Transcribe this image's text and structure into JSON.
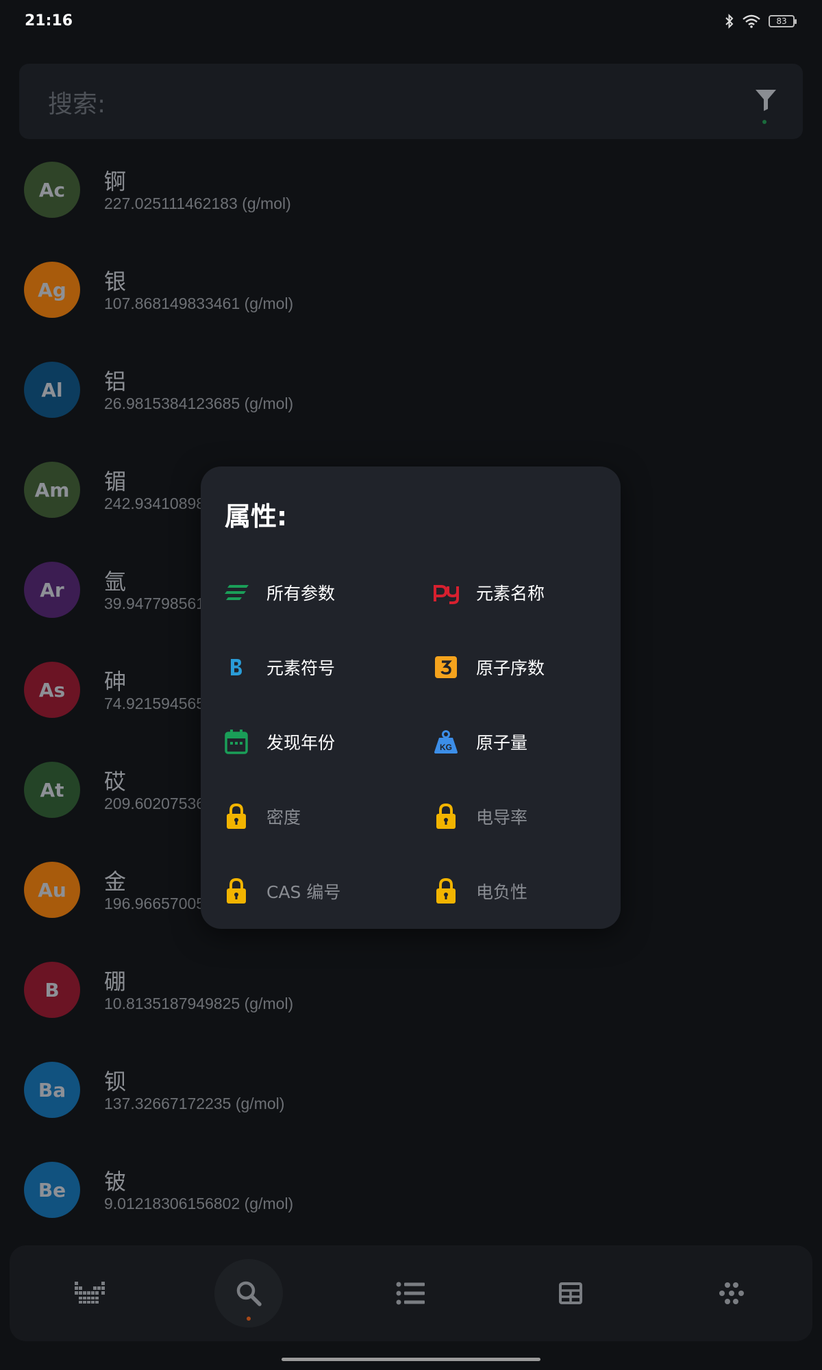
{
  "status_bar": {
    "time": "21:16",
    "battery": "83"
  },
  "search": {
    "label": "搜索:"
  },
  "elements": [
    {
      "symbol": "Ac",
      "name": "锕",
      "mass": "227.025111462183 (g/mol)",
      "color": "#2f4428"
    },
    {
      "symbol": "Ag",
      "name": "银",
      "mass": "107.868149833461 (g/mol)",
      "color": "#a85b0c"
    },
    {
      "symbol": "Al",
      "name": "铝",
      "mass": "26.9815384123685 (g/mol)",
      "color": "#0c3c5e"
    },
    {
      "symbol": "Am",
      "name": "镅",
      "mass": "242.934108982",
      "color": "#2f4428"
    },
    {
      "symbol": "Ar",
      "name": "氩",
      "mass": "39.947798561",
      "color": "#3c1d52"
    },
    {
      "symbol": "As",
      "name": "砷",
      "mass": "74.921594565",
      "color": "#6b1424"
    },
    {
      "symbol": "At",
      "name": "砹",
      "mass": "209.602075366",
      "color": "#244427"
    },
    {
      "symbol": "Au",
      "name": "金",
      "mass": "196.966570051",
      "color": "#a85b0c"
    },
    {
      "symbol": "B",
      "name": "硼",
      "mass": "10.8135187949825 (g/mol)",
      "color": "#6b1424"
    },
    {
      "symbol": "Ba",
      "name": "钡",
      "mass": "137.32667172235 (g/mol)",
      "color": "#11527f"
    },
    {
      "symbol": "Be",
      "name": "铍",
      "mass": "9.01218306156802 (g/mol)",
      "color": "#11527f"
    }
  ],
  "dialog": {
    "title": "属性:",
    "options": [
      {
        "label": "所有参数",
        "icon": "lines-icon",
        "locked": false
      },
      {
        "label": "元素名称",
        "icon": "pinyin-icon",
        "locked": false
      },
      {
        "label": "元素符号",
        "icon": "bold-b-icon",
        "locked": false
      },
      {
        "label": "原子序数",
        "icon": "number-three-icon",
        "locked": false
      },
      {
        "label": "发现年份",
        "icon": "calendar-icon",
        "locked": false
      },
      {
        "label": "原子量",
        "icon": "weight-kg-icon",
        "locked": false
      },
      {
        "label": "密度",
        "icon": "lock-icon",
        "locked": true
      },
      {
        "label": "电导率",
        "icon": "lock-icon",
        "locked": true
      },
      {
        "label": "CAS 编号",
        "icon": "lock-icon",
        "locked": true
      },
      {
        "label": "电负性",
        "icon": "lock-icon",
        "locked": true
      }
    ],
    "icon_colors": {
      "green": "#1a9e58",
      "red": "#d6202f",
      "blue": "#2a9dd8",
      "orange": "#f5a31d",
      "kg_blue": "#3c8ee8",
      "lock": "#f2b400"
    }
  },
  "bottom_nav": {
    "items": [
      "periodic-table-icon",
      "search-icon",
      "list-icon",
      "table-icon",
      "dots-grid-icon"
    ],
    "active": "search-icon"
  }
}
